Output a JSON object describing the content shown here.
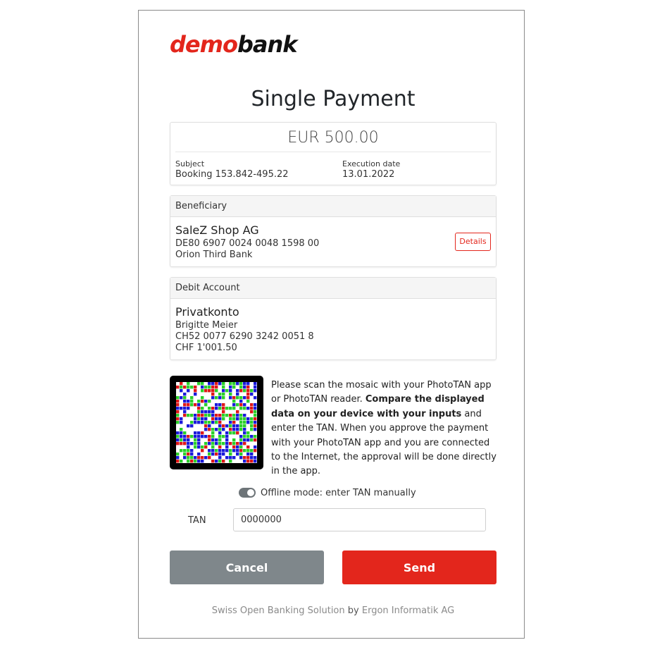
{
  "brand": {
    "part1": "demo",
    "part2": "bank",
    "accent": "#e3261c"
  },
  "page": {
    "title": "Single Payment"
  },
  "payment": {
    "amount": "EUR 500.00",
    "subject_label": "Subject",
    "subject_value": "Booking 153.842-495.22",
    "date_label": "Execution date",
    "date_value": "13.01.2022"
  },
  "beneficiary": {
    "header": "Beneficiary",
    "name": "SaleZ Shop AG",
    "iban": "DE80 6907 0024 0048 1598 00",
    "bank": "Orion Third Bank",
    "details_label": "Details"
  },
  "debit": {
    "header": "Debit Account",
    "name": "Privatkonto",
    "owner": "Brigitte Meier",
    "iban": "CH52 0077 6290 3242 0051 8",
    "balance": "CHF 1'001.50"
  },
  "instructions": {
    "part1": "Please scan the mosaic with your PhotoTAN app or PhotoTAN reader. ",
    "bold": "Compare the displayed data on your device with your inputs",
    "part2": " and enter the TAN. When you approve the payment with your PhotoTAN app and you are connected to the Internet, the approval will be done directly in the app."
  },
  "offline": {
    "label": "Offline mode: enter TAN manually",
    "enabled": true
  },
  "tan": {
    "label": "TAN",
    "value": "0000000"
  },
  "buttons": {
    "cancel": "Cancel",
    "send": "Send"
  },
  "footer": {
    "left": "Swiss Open Banking Solution",
    "mid": "by",
    "right": "Ergon Informatik AG"
  }
}
